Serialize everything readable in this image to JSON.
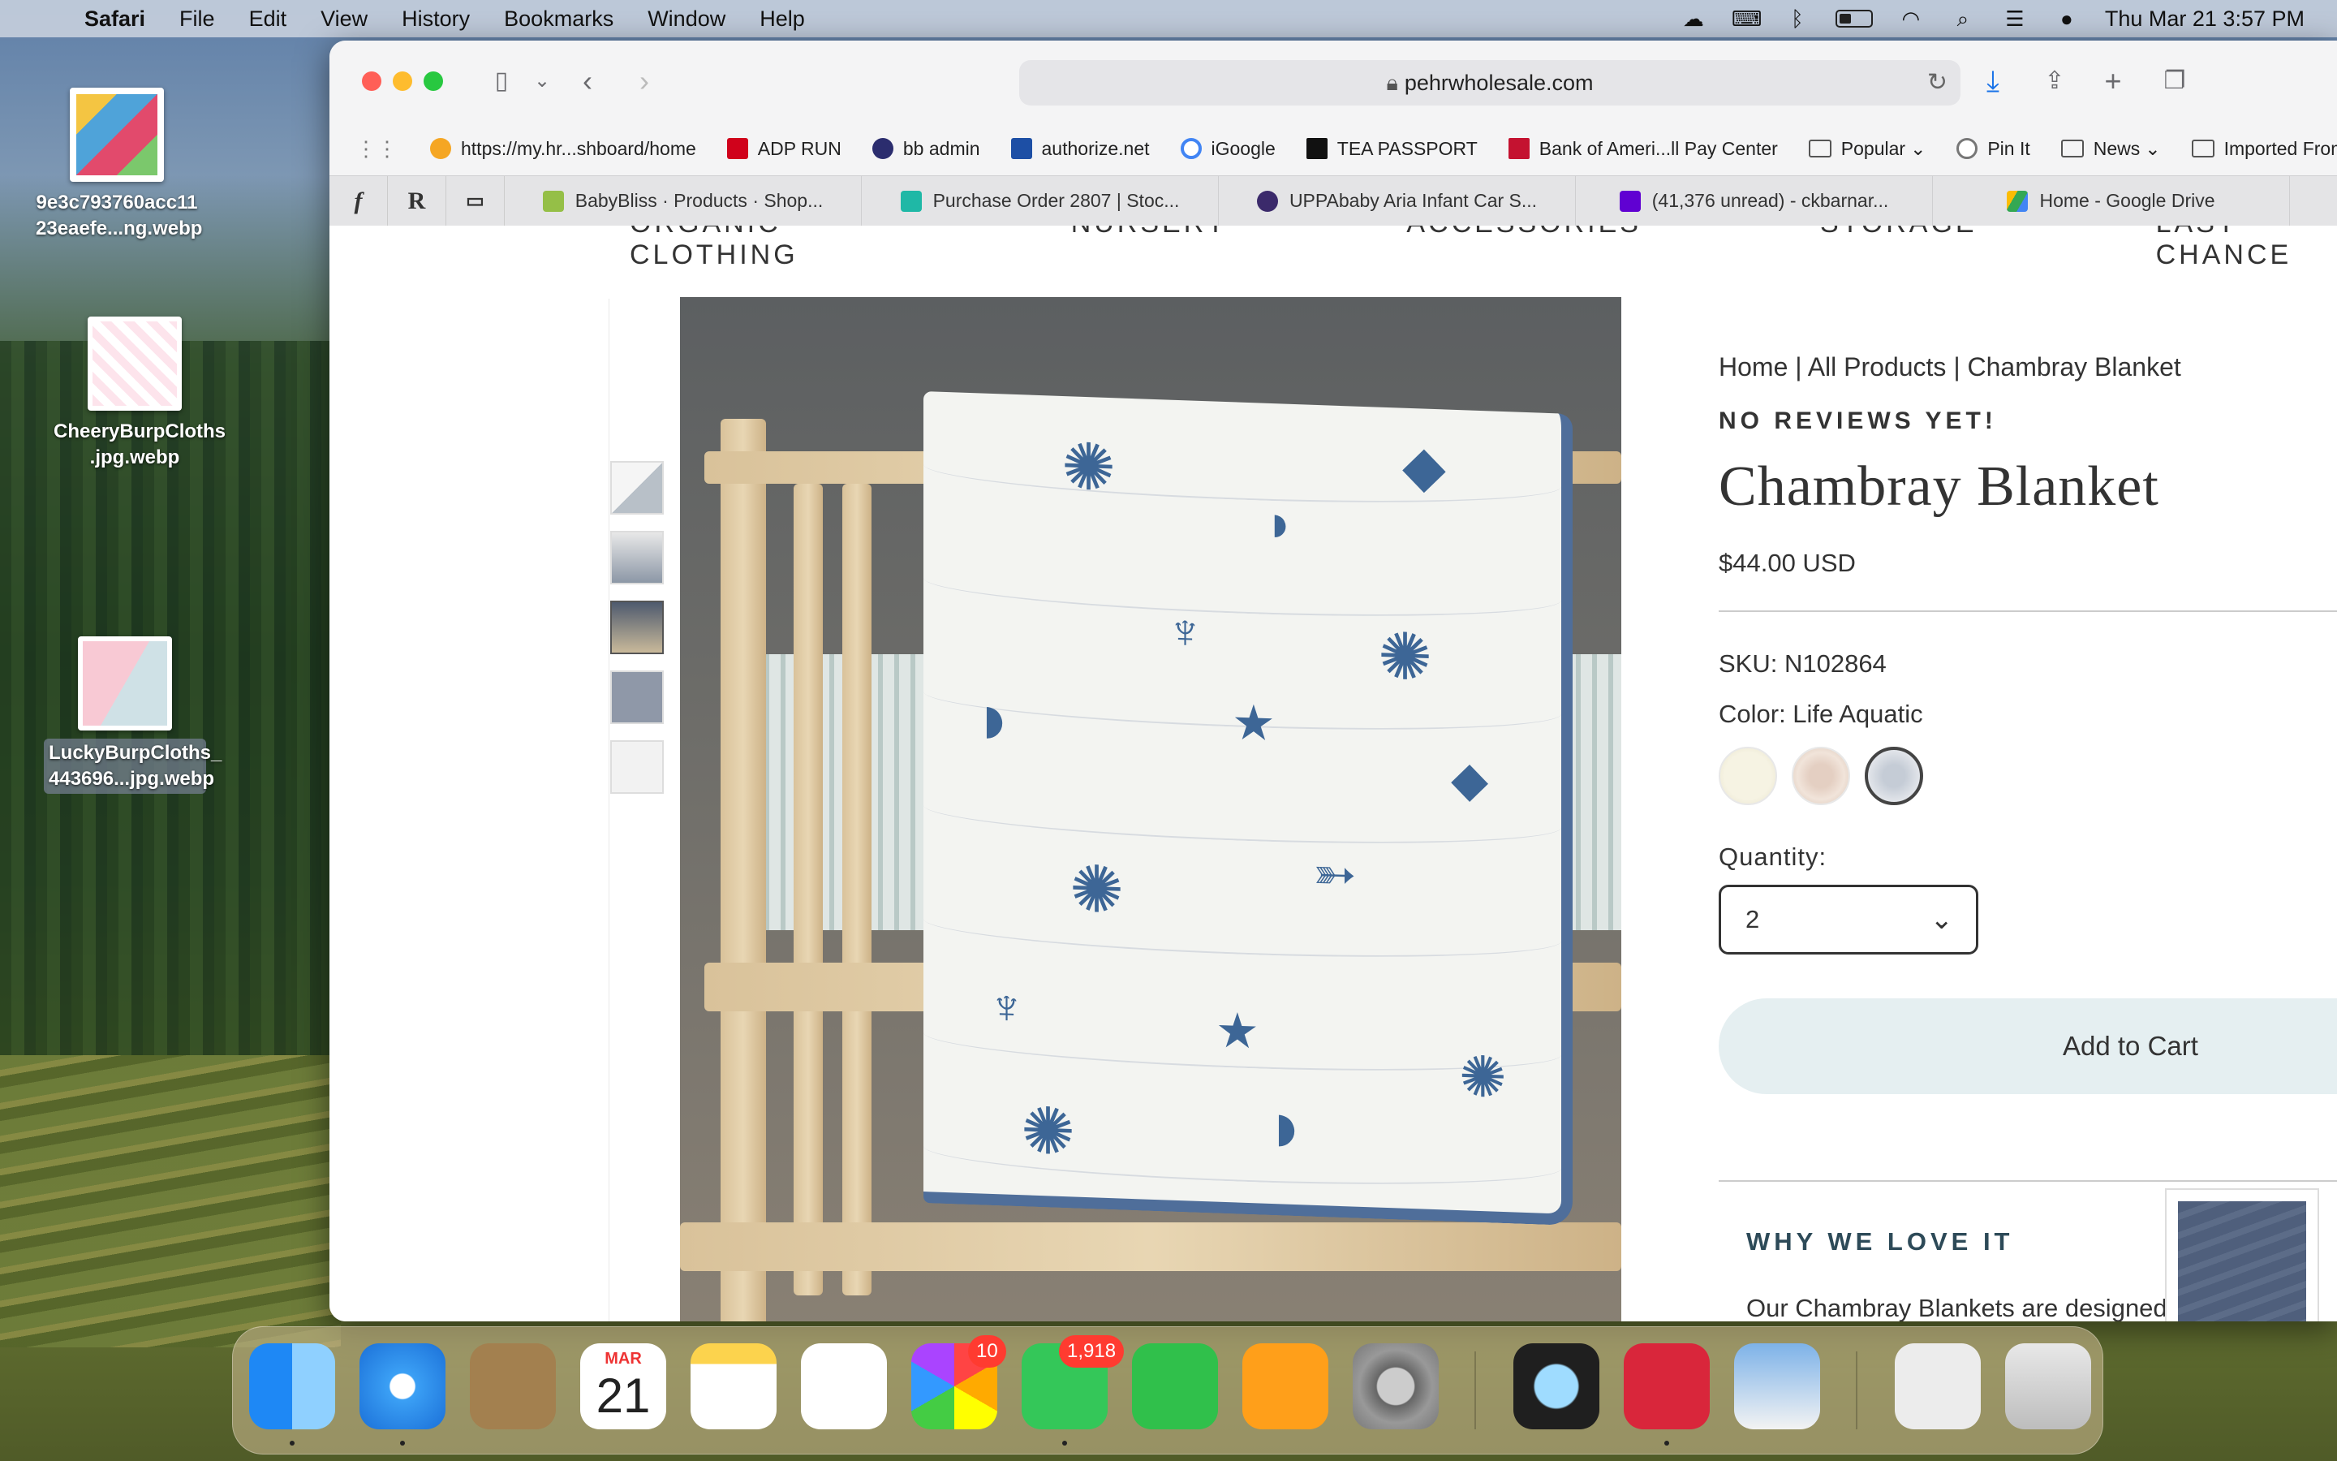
{
  "menubar": {
    "app": "Safari",
    "items": [
      "File",
      "Edit",
      "View",
      "History",
      "Bookmarks",
      "Window",
      "Help"
    ],
    "datetime": "Thu Mar 21  3:57 PM"
  },
  "desktop": {
    "files": [
      {
        "name": "9e3c793760acc11\n23eaefe...ng.webp"
      },
      {
        "name": "CheeryBurpCloths\n.jpg.webp"
      },
      {
        "name": "LuckyBurpCloths_\n443696...jpg.webp"
      }
    ]
  },
  "browser": {
    "address": "pehrwholesale.com",
    "favorites": [
      {
        "label": "https://my.hr...shboard/home",
        "color": "#f5a623"
      },
      {
        "label": "ADP RUN",
        "color": "#d0021b"
      },
      {
        "label": "bb admin",
        "color": "#2b2d6e"
      },
      {
        "label": "authorize.net",
        "color": "#1d4fa5"
      },
      {
        "label": "iGoogle",
        "color": "#4285f4"
      },
      {
        "label": "TEA PASSPORT",
        "color": "#111111"
      },
      {
        "label": "Bank of Ameri...ll Pay Center",
        "color": "#c41230"
      },
      {
        "label": "Popular",
        "folder": true
      },
      {
        "label": "Pin It",
        "color": "#777777"
      },
      {
        "label": "News",
        "folder": true
      },
      {
        "label": "Imported From",
        "folder": true
      }
    ],
    "pinned_tabs": [
      "f",
      "R",
      "▭"
    ],
    "tabs": [
      {
        "label": "BabyBliss · Products · Shop...",
        "color": "#95bf47"
      },
      {
        "label": "Purchase Order 2807 | Stoc...",
        "color": "#1fb8a6"
      },
      {
        "label": "UPPAbaby Aria Infant Car S...",
        "color": "#3b2a6b"
      },
      {
        "label": "(41,376 unread) - ckbarnar...",
        "color": "#6001d2"
      },
      {
        "label": "Home - Google Drive",
        "color": "#34a853"
      }
    ]
  },
  "page": {
    "nav": [
      "ORGANIC CLOTHING",
      "NURSERY",
      "ACCESSORIES",
      "STORAGE",
      "LAST CHANCE"
    ],
    "breadcrumb": "Home | All Products | Chambray Blanket",
    "reviews": "NO REVIEWS YET!",
    "title": "Chambray Blanket",
    "price": "$44.00 USD",
    "sku": "SKU: N102864",
    "color_label": "Color: Life Aquatic",
    "swatches": [
      {
        "name": "stars",
        "color": "#f2efe0"
      },
      {
        "name": "floral",
        "color": "#e8d8cc"
      },
      {
        "name": "life-aquatic",
        "color": "#d9dde3",
        "selected": true
      }
    ],
    "quantity_label": "Quantity:",
    "quantity": "2",
    "add_to_cart": "Add to Cart",
    "why_heading": "WHY WE LOVE IT",
    "description": "Our Chambray Blankets are designed and lovingly"
  },
  "dock": {
    "calendar_month": "MAR",
    "calendar_day": "21",
    "photos_badge": "10",
    "messages_badge": "1,918"
  }
}
